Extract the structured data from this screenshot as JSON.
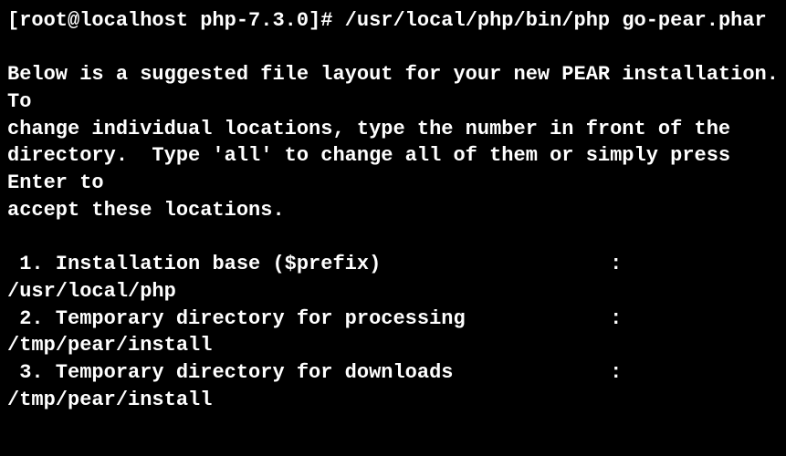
{
  "prompt": "[root@localhost php-7.3.0]# ",
  "command": "/usr/local/php/bin/php go-pear.phar",
  "blank": "",
  "intro": "Below is a suggested file layout for your new PEAR installation.  To\nchange individual locations, type the number in front of the directory.  Type 'all' to change all of them or simply press Enter to\naccept these locations.",
  "options": [
    " 1. Installation base ($prefix)                   : /usr/local/php",
    " 2. Temporary directory for processing            : /tmp/pear/install",
    " 3. Temporary directory for downloads             : /tmp/pear/install"
  ]
}
